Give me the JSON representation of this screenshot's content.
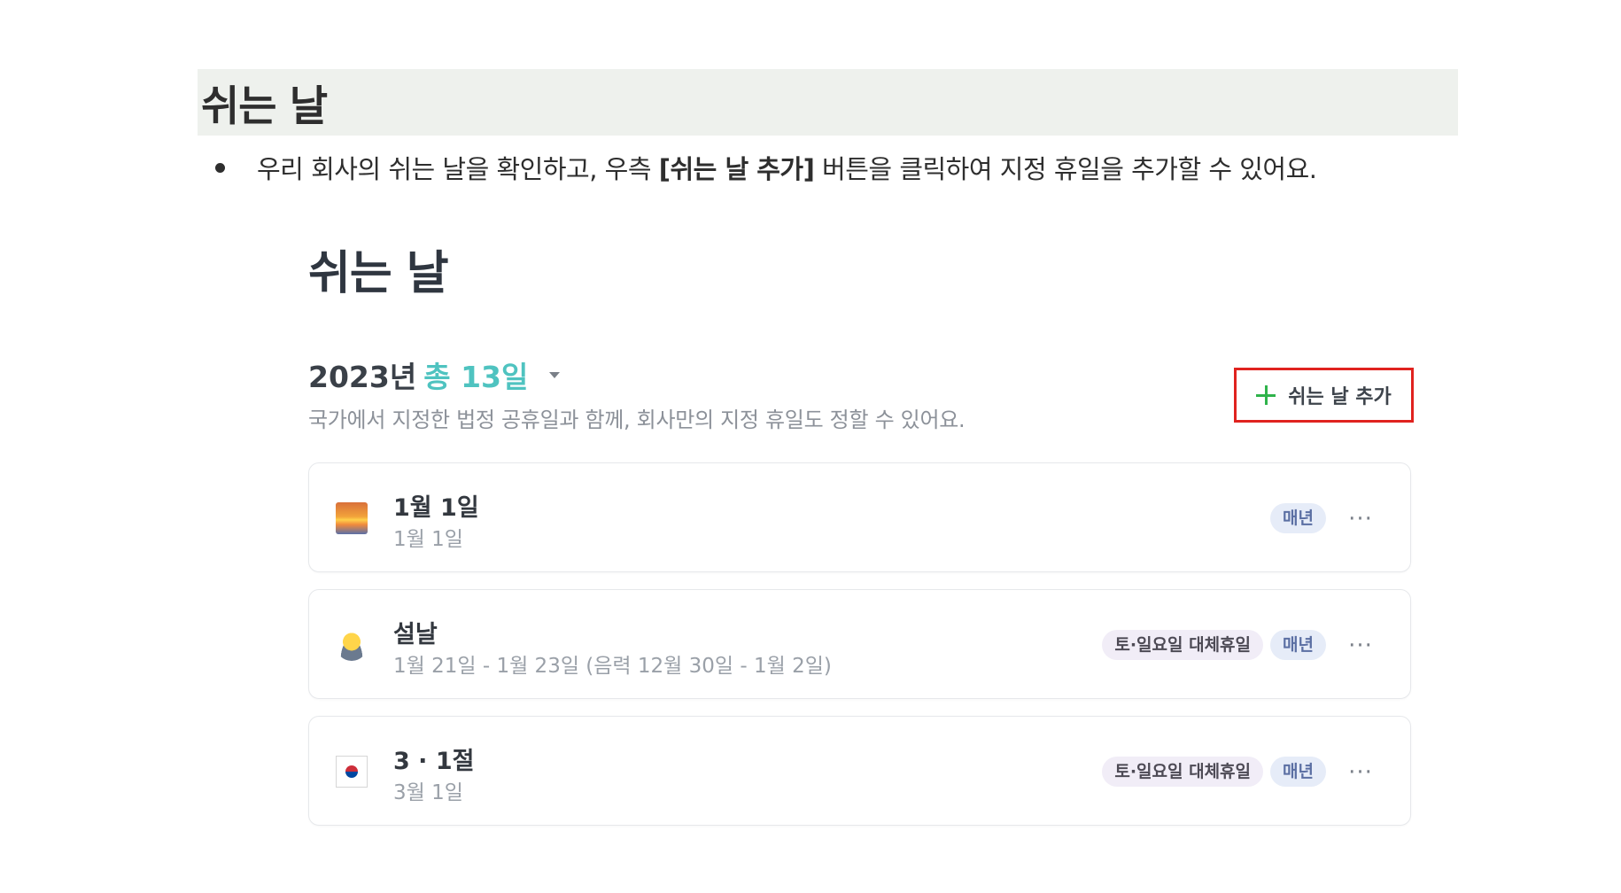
{
  "doc": {
    "heading": "쉬는 날",
    "bullet_before": "우리 회사의 쉬는 날을 확인하고, 우측 ",
    "bullet_bold": "[쉬는 날 추가]",
    "bullet_after": " 버튼을 클릭하여 지정 휴일을 추가할 수 있어요."
  },
  "app": {
    "title": "쉬는 날",
    "year": "2023년",
    "total": "총 13일",
    "subtitle": "국가에서 지정한 법정 공휴일과 함께, 회사만의 지정 휴일도 정할 수 있어요.",
    "add_button_label": "쉬는 날 추가",
    "add_button_icon": "plus-icon",
    "highlight_color": "#e0231f",
    "accent_color": "#4fc3c0",
    "holidays": [
      {
        "icon": "sunrise-icon",
        "name": "1월 1일",
        "date": "1월 1일",
        "tags": [
          "매년"
        ]
      },
      {
        "icon": "person-bowing-icon",
        "name": "설날",
        "date": "1월 21일 - 1월 23일 (음력 12월 30일 - 1월 2일)",
        "tags": [
          "토·일요일 대체휴일",
          "매년"
        ]
      },
      {
        "icon": "korea-flag-icon",
        "name": "3 · 1절",
        "date": "3월 1일",
        "tags": [
          "토·일요일 대체휴일",
          "매년"
        ]
      }
    ],
    "more_label": "···"
  }
}
